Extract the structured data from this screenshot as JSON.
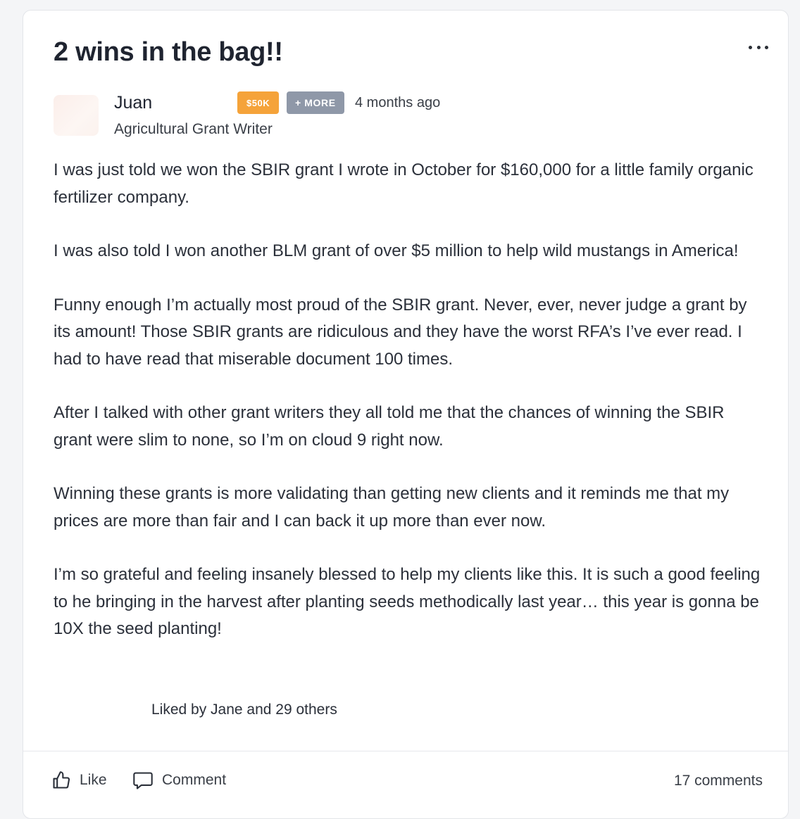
{
  "post": {
    "title": "2 wins in the bag!!",
    "more_icon": "ellipsis-icon"
  },
  "author": {
    "name": "Juan",
    "role": "Agricultural Grant Writer",
    "badge": "$50K",
    "more_badge": "+ MORE",
    "timestamp": "4 months ago"
  },
  "body": {
    "paragraphs": [
      "I was just told we won the SBIR grant I wrote in October for $160,000 for a little family organic fertilizer company.",
      "I was also told I won another BLM grant of over $5 million to help wild mustangs in America!",
      "Funny enough I’m actually most proud of the SBIR grant. Never, ever, never judge a grant by its amount! Those SBIR grants are ridiculous and they have the worst RFA’s I’ve ever read. I had to have read that miserable document 100 times.",
      "After I talked with other grant writers they all told me that the chances of winning the SBIR grant were slim to none, so I’m on cloud 9 right now.",
      "Winning these grants is more validating than getting new clients and it reminds me that my prices are more than fair and I can back it up more than ever now.",
      "I’m so grateful and feeling insanely blessed to help my clients like this. It is such a good feeling to he bringing in the harvest after planting seeds methodically last year… this year is gonna be 10X the seed planting!"
    ]
  },
  "likes": {
    "text": "Liked by Jane and 29 others"
  },
  "actions": {
    "like_label": "Like",
    "like_icon": "thumbs-up-icon",
    "comment_label": "Comment",
    "comment_icon": "speech-bubble-icon",
    "comment_count": "17 comments"
  },
  "colors": {
    "badge_50k": "#f5a33a",
    "badge_more": "#8f98a8"
  }
}
